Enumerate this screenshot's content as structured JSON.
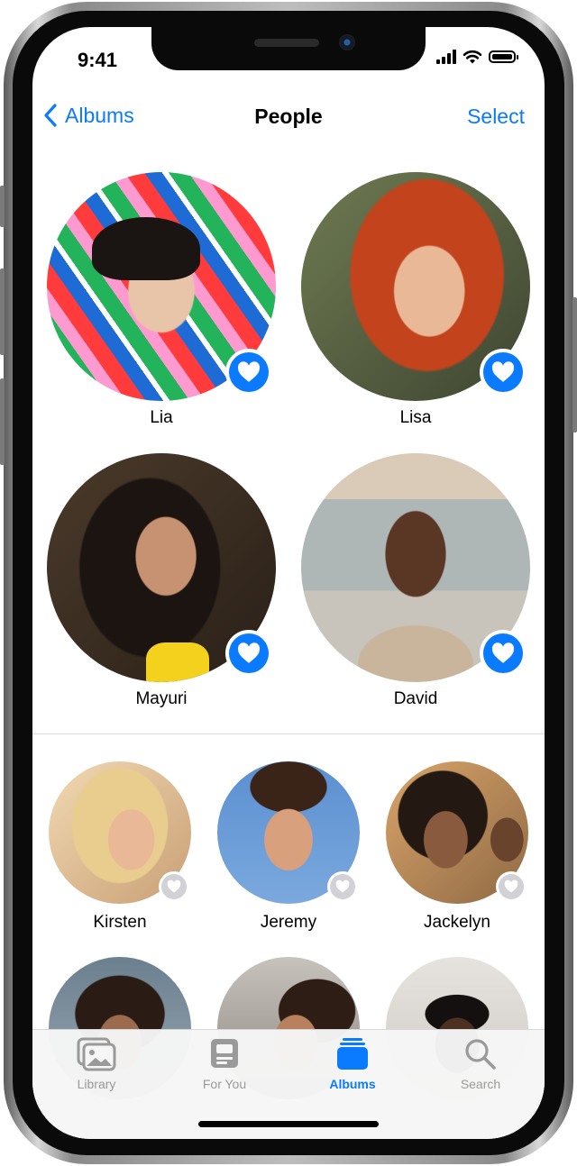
{
  "status_bar": {
    "time": "9:41"
  },
  "nav": {
    "back_label": "Albums",
    "title": "People",
    "action_label": "Select"
  },
  "favorites": [
    {
      "name": "Lia",
      "favorited": true
    },
    {
      "name": "Lisa",
      "favorited": true
    },
    {
      "name": "Mayuri",
      "favorited": true
    },
    {
      "name": "David",
      "favorited": true
    }
  ],
  "people": [
    {
      "name": "Kirsten",
      "favorited": false
    },
    {
      "name": "Jeremy",
      "favorited": false
    },
    {
      "name": "Jackelyn",
      "favorited": false
    }
  ],
  "tab_bar": {
    "tabs": [
      {
        "label": "Library",
        "icon": "photos-icon",
        "active": false
      },
      {
        "label": "For You",
        "icon": "for-you-icon",
        "active": false
      },
      {
        "label": "Albums",
        "icon": "albums-icon",
        "active": true
      },
      {
        "label": "Search",
        "icon": "search-icon",
        "active": false
      }
    ]
  },
  "colors": {
    "accent": "#0a7aff",
    "inactive_tab": "#9a9a9a"
  }
}
